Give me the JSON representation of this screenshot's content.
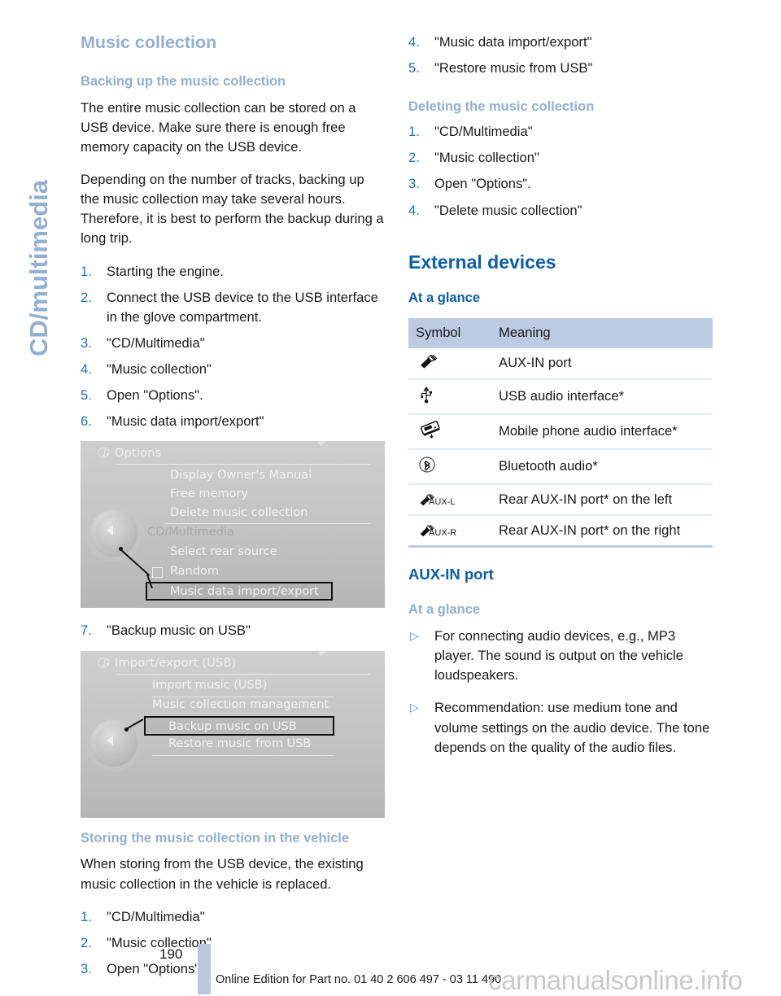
{
  "sidebar": {
    "tab_label": "CD/multimedia"
  },
  "left_column": {
    "chapter_title": "Music collection",
    "backup_heading": "Backing up the music collection",
    "backup_paragraphs": [
      "The entire music collection can be stored on a USB device. Make sure there is enough free memory capacity on the USB device.",
      "Depending on the number of tracks, backing up the music collection may take several hours. Therefore, it is best to perform the backup during a long trip."
    ],
    "backup_steps": [
      {
        "num": "1.",
        "text": "Starting the engine."
      },
      {
        "num": "2.",
        "text": "Connect the USB device to the USB interface in the glove compartment."
      },
      {
        "num": "3.",
        "text": "\"CD/Multimedia\""
      },
      {
        "num": "4.",
        "text": "\"Music collection\""
      },
      {
        "num": "5.",
        "text": "Open \"Options\"."
      },
      {
        "num": "6.",
        "text": "\"Music data import/export\""
      }
    ],
    "step7": {
      "num": "7.",
      "text": "\"Backup music on USB\""
    },
    "storing_heading": "Storing the music collection in the vehicle",
    "storing_paragraph": "When storing from the USB device, the existing music collection in the vehicle is replaced.",
    "storing_steps": [
      {
        "num": "1.",
        "text": "\"CD/Multimedia\""
      },
      {
        "num": "2.",
        "text": "\"Music collection\""
      },
      {
        "num": "3.",
        "text": "Open \"Options\"."
      }
    ]
  },
  "screenshot_options": {
    "title": "Options",
    "title_icon": "multimedia-note-icon",
    "items": [
      "Display Owner's Manual",
      "Free memory",
      "Delete music collection"
    ],
    "group_label": "CD/Multimedia",
    "items2": [
      "Select rear source",
      "Random"
    ],
    "highlighted_item": "Music data import/export"
  },
  "screenshot_importexport": {
    "title": "Import/export (USB)",
    "title_icon": "multimedia-note-icon",
    "items": [
      "Import music (USB)",
      "Music collection management"
    ],
    "highlighted_item": "Backup music on USB",
    "items2": [
      "Restore music from USB"
    ]
  },
  "right_column": {
    "continued_steps": [
      {
        "num": "4.",
        "text": "\"Music data import/export\""
      },
      {
        "num": "5.",
        "text": "\"Restore music from USB\""
      }
    ],
    "deleting_heading": "Deleting the music collection",
    "deleting_steps": [
      {
        "num": "1.",
        "text": "\"CD/Multimedia\""
      },
      {
        "num": "2.",
        "text": "\"Music collection\""
      },
      {
        "num": "3.",
        "text": "Open \"Options\"."
      },
      {
        "num": "4.",
        "text": "\"Delete music collection\""
      }
    ],
    "external_devices_title": "External devices",
    "at_a_glance_dark": "At a glance",
    "symbol_table": {
      "headers": [
        "Symbol",
        "Meaning"
      ],
      "rows": [
        {
          "symbol_name": "aux-in-plug-icon",
          "meaning": "AUX-IN port"
        },
        {
          "symbol_name": "usb-trident-icon",
          "meaning": "USB audio interface*"
        },
        {
          "symbol_name": "mobile-phone-audio-icon",
          "meaning": "Mobile phone audio interface*"
        },
        {
          "symbol_name": "bluetooth-icon",
          "meaning": "Bluetooth audio*"
        },
        {
          "symbol_name": "rear-aux-l-icon",
          "symbol_label": "AUX-L",
          "meaning": "Rear AUX-IN port* on the left"
        },
        {
          "symbol_name": "rear-aux-r-icon",
          "symbol_label": "AUX-R",
          "meaning": "Rear AUX-IN port* on the right"
        }
      ]
    },
    "aux_in_port_title": "AUX-IN port",
    "at_a_glance_light": "At a glance",
    "aux_bullets": [
      "For connecting audio devices, e.g., MP3 player. The sound is output on the vehicle loudspeakers.",
      "Recommendation: use medium tone and volume settings on the audio device. The tone depends on the quality of the audio files."
    ]
  },
  "footer": {
    "page_number": "190",
    "edition_text": "Online Edition for Part no. 01 40 2 606 497 - 03 11 490",
    "watermark": "carmanualsonline.info"
  },
  "colors": {
    "heading_light_blue": "#93afd4",
    "heading_dark_blue": "#0b5ea8",
    "list_number_blue": "#1a72c4",
    "table_header_bg": "#bccbe2",
    "footer_bar": "#b9c8e0"
  }
}
